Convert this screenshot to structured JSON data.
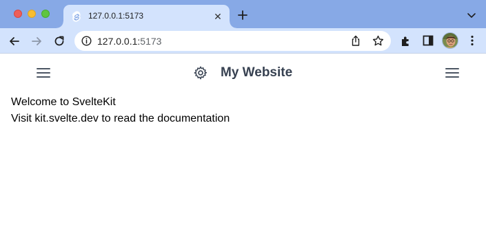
{
  "browser": {
    "tab": {
      "title": "127.0.0.1:5173",
      "close_glyph": "✕",
      "favicon": "svelte-icon"
    },
    "address": {
      "host": "127.0.0.1:",
      "port": "5173"
    },
    "colors": {
      "tabstrip": "#87a9e6",
      "toolbar": "#d3e3fd",
      "close": "#ee5f58",
      "minimize": "#f8bd30",
      "maximize": "#5fc53f"
    },
    "icons": [
      "back-icon",
      "forward-icon",
      "reload-icon",
      "info-icon",
      "share-icon",
      "star-icon",
      "extensions-icon",
      "side-panel-icon",
      "avatar",
      "more-menu-icon"
    ]
  },
  "site": {
    "title": "My Website",
    "logo": "gear-icon",
    "left_menu": "hamburger-icon",
    "right_menu": "hamburger-icon",
    "text_color": "#374151"
  },
  "main": {
    "heading": "Welcome to SvelteKit",
    "body": "Visit kit.svelte.dev to read the documentation"
  }
}
